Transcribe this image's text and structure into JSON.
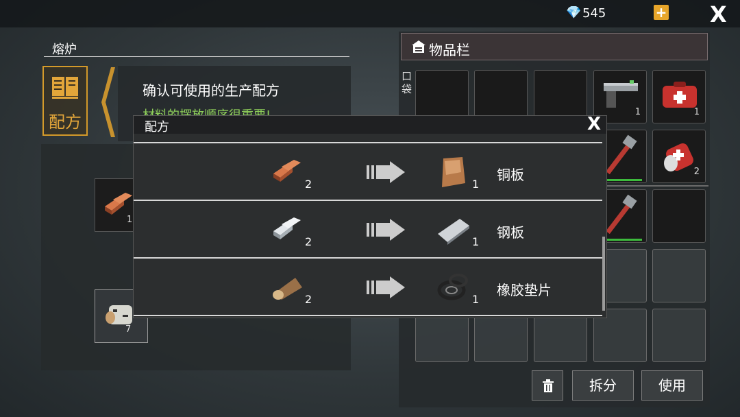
{
  "topbar": {
    "gem_icon": "diamond-icon",
    "gem_count": "545",
    "plus": "+",
    "close": "X"
  },
  "furnace": {
    "title": "熔炉",
    "tab_label": "配方",
    "info_title": "确认可使用的生产配方",
    "info_sub": "材料的摆放顺序很重要!",
    "slot_a_count": "1",
    "slot_b_count": "7"
  },
  "inventory": {
    "title": "物品栏",
    "pocket": "口袋",
    "slots": [
      {
        "icon": "empty",
        "count": ""
      },
      {
        "icon": "empty",
        "count": ""
      },
      {
        "icon": "empty",
        "count": ""
      },
      {
        "icon": "pistol-icon",
        "count": "1"
      },
      {
        "icon": "medkit-bag-icon",
        "count": "1"
      },
      {
        "icon": "hidden",
        "count": ""
      },
      {
        "icon": "hidden",
        "count": ""
      },
      {
        "icon": "hidden",
        "count": ""
      },
      {
        "icon": "pipe-wrench-icon",
        "count": ""
      },
      {
        "icon": "medkit-can-icon",
        "count": "2"
      },
      {
        "icon": "hidden",
        "count": ""
      },
      {
        "icon": "hidden",
        "count": ""
      },
      {
        "icon": "hidden",
        "count": ""
      },
      {
        "icon": "pipe-wrench-icon",
        "count": ""
      },
      {
        "icon": "empty",
        "count": ""
      }
    ],
    "split_label": "拆分",
    "use_label": "使用",
    "trash_icon": "trash-icon"
  },
  "dialog": {
    "title": "配方",
    "close": "X",
    "recipes": [
      {
        "input_icon": "copper-ingot-icon",
        "input_count": "2",
        "output_icon": "copper-plate-icon",
        "output_count": "1",
        "output_name": "铜板"
      },
      {
        "input_icon": "steel-ingot-icon",
        "input_count": "2",
        "output_icon": "steel-plate-icon",
        "output_count": "1",
        "output_name": "钢板"
      },
      {
        "input_icon": "wood-log-icon",
        "input_count": "2",
        "output_icon": "rubber-gasket-icon",
        "output_count": "1",
        "output_name": "橡胶垫片"
      }
    ]
  },
  "colors": {
    "accent": "#e3a63a",
    "green_text": "#8fd05a",
    "hp_green": "#3dbb3d"
  }
}
